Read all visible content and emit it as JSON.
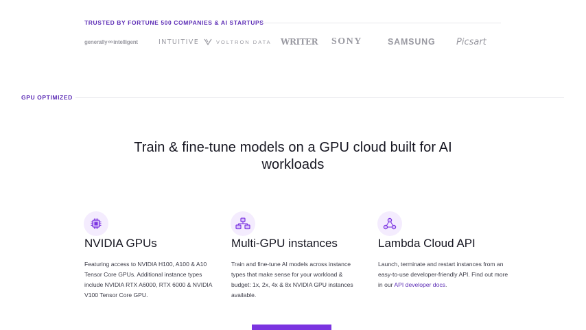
{
  "trusted": {
    "label": "TRUSTED BY FORTUNE 500 COMPANIES & AI STARTUPS",
    "logos": {
      "generally_intelligent_a": "generally",
      "generally_intelligent_b": "intelligent",
      "intuitive": "INTUITIVE",
      "voltron": "VOLTRON DATA",
      "writer": "WRITER",
      "sony": "SONY",
      "samsung": "SAMSUNG",
      "picsart": "Picsart"
    }
  },
  "section": {
    "label": "GPU OPTIMIZED",
    "headline": "Train & fine-tune models on a GPU cloud built for AI workloads"
  },
  "features": [
    {
      "icon": "gpu-chip-icon",
      "title": "NVIDIA GPUs",
      "description": "Featuring access to NVIDIA H100, A100 & A10 Tensor Core GPUs. Additional instance types include NVIDIA RTX A6000, RTX 6000 & NVIDIA V100 Tensor Core GPU."
    },
    {
      "icon": "multi-gpu-network-icon",
      "title": "Multi-GPU instances",
      "description": "Train and fine-tune AI models across instance types that make sense for your workload & budget: 1x, 2x, 4x & 8x NVIDIA GPU instances available."
    },
    {
      "icon": "api-nodes-icon",
      "title": "Lambda Cloud API",
      "description_prefix": "Launch, terminate and restart instances from an easy-to-use developer-friendly API. Find out more in our ",
      "link_text": "API developer docs",
      "description_suffix": "."
    }
  ],
  "colors": {
    "accent": "#5b2bb5",
    "cta": "#7b34e0",
    "icon_bg": "#f4ecfe",
    "logo_gray": "#9a9aa2"
  }
}
